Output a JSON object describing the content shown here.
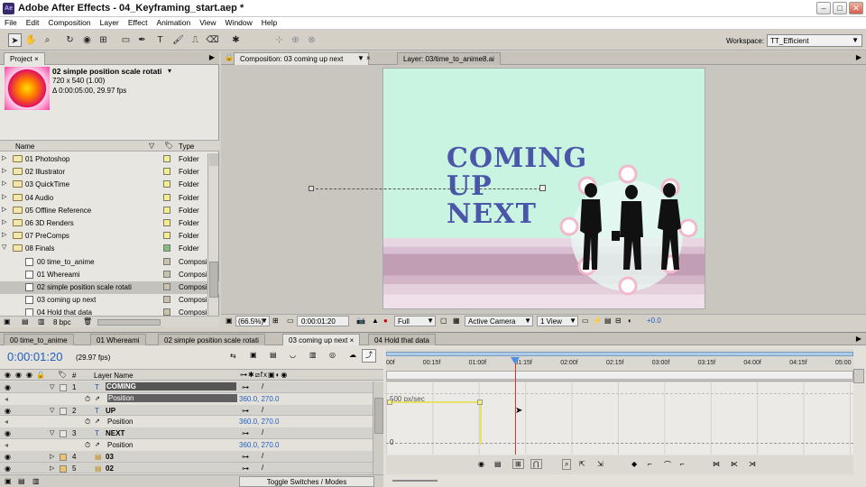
{
  "window": {
    "title": "Adobe After Effects - 04_Keyframing_start.aep *"
  },
  "menu": [
    "File",
    "Edit",
    "Composition",
    "Layer",
    "Effect",
    "Animation",
    "View",
    "Window",
    "Help"
  ],
  "workspace": {
    "label": "Workspace:",
    "value": "TT_Efficient"
  },
  "project": {
    "tab": "Project",
    "item_name": "02 simple position scale rotati",
    "item_dims": "720 x 540 (1.00)",
    "item_duration": "Δ 0:00:05:00, 29.97 fps",
    "col_name": "Name",
    "col_type": "Type",
    "rows": [
      {
        "name": "01 Photoshop",
        "type": "Folder",
        "kind": "folder",
        "color": "#f4ef8a"
      },
      {
        "name": "02 Illustrator",
        "type": "Folder",
        "kind": "folder",
        "color": "#f4ef8a"
      },
      {
        "name": "03 QuickTime",
        "type": "Folder",
        "kind": "folder",
        "color": "#f4ef8a"
      },
      {
        "name": "04 Audio",
        "type": "Folder",
        "kind": "folder",
        "color": "#f4ef8a"
      },
      {
        "name": "05 Offline Reference",
        "type": "Folder",
        "kind": "folder",
        "color": "#f4ef8a"
      },
      {
        "name": "06 3D Renders",
        "type": "Folder",
        "kind": "folder",
        "color": "#f4ef8a"
      },
      {
        "name": "07 PreComps",
        "type": "Folder",
        "kind": "folder",
        "color": "#f4ef8a"
      },
      {
        "name": "08 Finals",
        "type": "Folder",
        "kind": "folder",
        "color": "#7fbf7f"
      },
      {
        "name": "00 time_to_anime",
        "type": "Composi",
        "kind": "comp",
        "color": "#c9c3ad"
      },
      {
        "name": "01 Whereami",
        "type": "Composi",
        "kind": "comp",
        "color": "#c9c3ad"
      },
      {
        "name": "02 simple position scale rotati",
        "type": "Composi",
        "kind": "comp",
        "color": "#c9c3ad"
      },
      {
        "name": "03 coming up next",
        "type": "Composi",
        "kind": "comp",
        "color": "#c9c3ad"
      },
      {
        "name": "04 Hold that data",
        "type": "Composi",
        "kind": "comp",
        "color": "#c9c3ad"
      }
    ],
    "bpc": "8 bpc"
  },
  "viewer": {
    "comp_tab": "Composition: 03 coming up next",
    "layer_tab": "Layer: 03/time_to_anime8.ai",
    "art_text": [
      "COMING",
      "UP",
      "NEXT"
    ],
    "zoom": "(66.5%)",
    "timecode": "0:00:01:20",
    "resolution": "Full",
    "camera": "Active Camera",
    "views": "1 View",
    "offset": "+0.0"
  },
  "timeline_tabs": [
    "00 time_to_anime",
    "01 Whereami",
    "02 simple position scale rotati",
    "03 coming up next",
    "04 Hold that data"
  ],
  "timeline": {
    "timecode": "0:00:01:20",
    "fps": "(29.97 fps)",
    "col_layer_name": "Layer Name",
    "col_hash": "#",
    "ruler": [
      "00f",
      "00:15f",
      "01:00f",
      "01:15f",
      "02:00f",
      "02:15f",
      "03:00f",
      "03:15f",
      "04:00f",
      "04:15f",
      "05:00"
    ],
    "graph_label": "500 px/sec",
    "graph_zero": "0",
    "toggle": "Toggle Switches / Modes",
    "layers": [
      {
        "num": "1",
        "name": "COMING",
        "prop": "Position",
        "value": "360.0, 270.0"
      },
      {
        "num": "2",
        "name": "UP",
        "prop": "Position",
        "value": "360.0, 270.0"
      },
      {
        "num": "3",
        "name": "NEXT",
        "prop": "Position",
        "value": "360.0, 270.0"
      },
      {
        "num": "4",
        "name": "03"
      },
      {
        "num": "5",
        "name": "02"
      }
    ]
  }
}
